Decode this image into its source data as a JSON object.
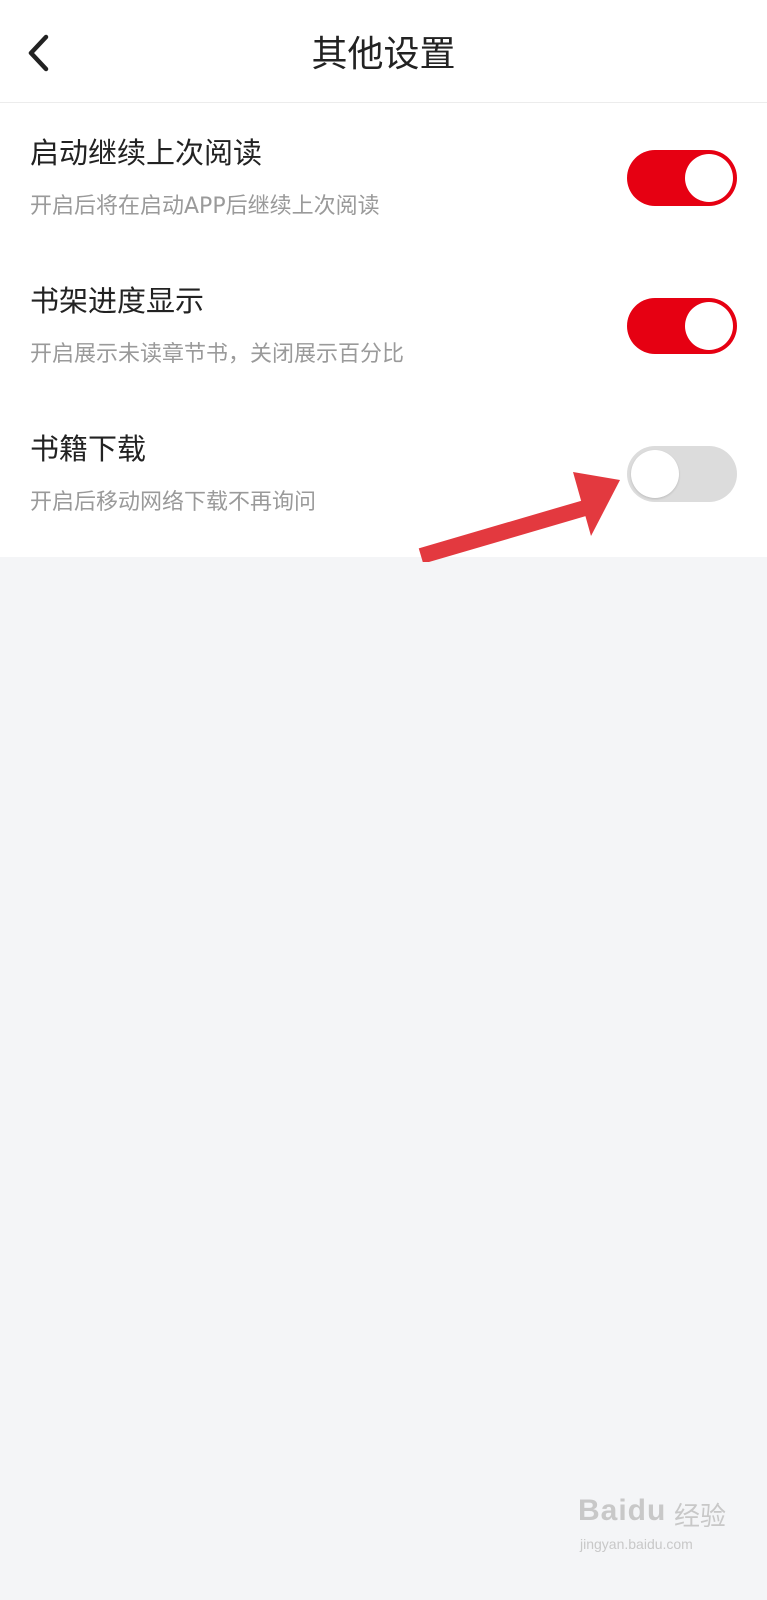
{
  "header": {
    "title": "其他设置",
    "back_icon": "chevron-left-icon"
  },
  "settings": [
    {
      "title": "启动继续上次阅读",
      "description": "开启后将在启动APP后继续上次阅读",
      "enabled": true
    },
    {
      "title": "书架进度显示",
      "description": "开启展示未读章节书，关闭展示百分比",
      "enabled": true
    },
    {
      "title": "书籍下载",
      "description": "开启后移动网络下载不再询问",
      "enabled": false
    }
  ],
  "colors": {
    "toggle_on": "#e60012",
    "toggle_off": "#dcdcdc",
    "arrow": "#e3393f",
    "background": "#f4f5f7"
  },
  "watermark": {
    "brand_latin": "Baidu",
    "brand_cjk": "经验",
    "url": "jingyan.baidu.com"
  }
}
